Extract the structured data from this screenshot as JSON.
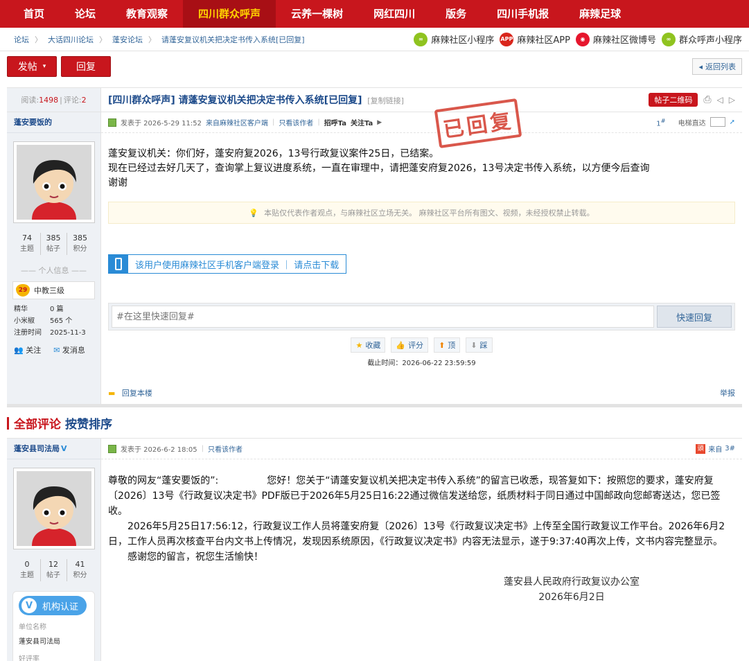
{
  "nav": {
    "items": [
      {
        "label": "首页"
      },
      {
        "label": "论坛"
      },
      {
        "label": "教育观察"
      },
      {
        "label": "四川群众呼声"
      },
      {
        "label": "云养一棵树"
      },
      {
        "label": "网红四川"
      },
      {
        "label": "版务"
      },
      {
        "label": "四川手机报"
      },
      {
        "label": "麻辣足球"
      }
    ],
    "active_index": 3
  },
  "breadcrumb": {
    "items": [
      "论坛",
      "大话四川论坛",
      "蓬安论坛",
      "请蓬安复议机关把决定书传入系统[已回复]"
    ]
  },
  "social": {
    "mini_program": "麻辣社区小程序",
    "app": "麻辣社区APP",
    "weibo": "麻辣社区微博号",
    "voice_mini": "群众呼声小程序"
  },
  "actions": {
    "post": "发帖",
    "reply": "回复",
    "back": "返回列表"
  },
  "thread": {
    "reads_label": "阅读:",
    "reads": "1498",
    "comments_label": "评论:",
    "comments": "2",
    "title": "[四川群众呼声] 请蓬安复议机关把决定书传入系统[已回复]",
    "copy_link": "[复制链接]",
    "qr_button": "帖子二维码",
    "stamp": "已回复"
  },
  "post1": {
    "author": "蓬安要饭的",
    "stats": [
      {
        "value": "74",
        "label": "主题"
      },
      {
        "value": "385",
        "label": "帖子"
      },
      {
        "value": "385",
        "label": "积分"
      }
    ],
    "info_header": "个人信息",
    "level_num": "29",
    "level_name": "中教三级",
    "info": [
      {
        "k": "精华",
        "v": "0 篇"
      },
      {
        "k": "小米椒",
        "v": "565 个"
      },
      {
        "k": "注册时间",
        "v": "2025-11-3"
      }
    ],
    "follow": "关注",
    "message": "发消息",
    "posted_at": "发表于 2026-5-29 11:52",
    "from_client": "来自麻辣社区客户端",
    "only_author": "只看该作者",
    "greet": "招呼Ta",
    "follow_ta": "关注Ta",
    "floor": "1",
    "elevator": "电梯直达",
    "lines": [
      "蓬安复议机关：你们好，蓬安府复2026，13号行政复议案件25日，已结案。",
      "现在已经过去好几天了，查询掌上复议进度系统，一直在审理中，请把蓬安府复2026，13号决定书传入系统，以方便今后查询",
      "谢谢"
    ],
    "notice": "本贴仅代表作者观点，与麻辣社区立场无关。 麻辣社区平台所有图文、视频，未经授权禁止转载。",
    "app_login": "该用户使用麻辣社区手机客户端登录 ｜ 请点击下载",
    "quick_reply_placeholder": "#在这里快速回复#",
    "quick_reply_button": "快速回复",
    "votes": [
      "收藏",
      "评分",
      "顶",
      "踩"
    ],
    "deadline": "截止时间：2026-06-22 23:59:59",
    "reply_floor": "回复本楼",
    "report": "举报"
  },
  "comments_header": {
    "all": "全部评论",
    "sort": "按赞排序"
  },
  "post2": {
    "author": "蓬安县司法局",
    "verified": "V",
    "stats": [
      {
        "value": "0",
        "label": "主题"
      },
      {
        "value": "12",
        "label": "帖子"
      },
      {
        "value": "41",
        "label": "积分"
      }
    ],
    "cert": "机构认证",
    "unit_label": "单位名称",
    "unit_value": "蓬安县司法局",
    "more_label": "好评率",
    "posted_at": "发表于 2026-6-2 18:05",
    "only_author": "只看该作者",
    "from": "来自",
    "floor": "3",
    "p1": "尊敬的网友“蓬安要饭的”:　　　　　您好！您关于“请蓬安复议机关把决定书传入系统”的留言已收悉，现答复如下：按照您的要求，蓬安府复〔2026〕13号《行政复议决定书》PDF版已于2026年5月25日16:22通过微信发送给您，纸质材料于同日通过中国邮政向您邮寄送达，您已签收。",
    "p2": "2026年5月25日17:56:12，行政复议工作人员将蓬安府复〔2026〕13号《行政复议决定书》上传至全国行政复议工作平台。2026年6月2日，工作人员再次核查平台内文书上传情况，发现因系统原因，《行政复议决定书》内容无法显示，遂于9:37:40再次上传，文书内容完整显示。",
    "p3": "感谢您的留言，祝您生活愉快！",
    "sign_org": "蓬安县人民政府行政复议办公室",
    "sign_date": "2026年6月2日"
  },
  "colors": {
    "brand": "#c8161d",
    "link": "#336699",
    "title": "#1c4a8a"
  }
}
